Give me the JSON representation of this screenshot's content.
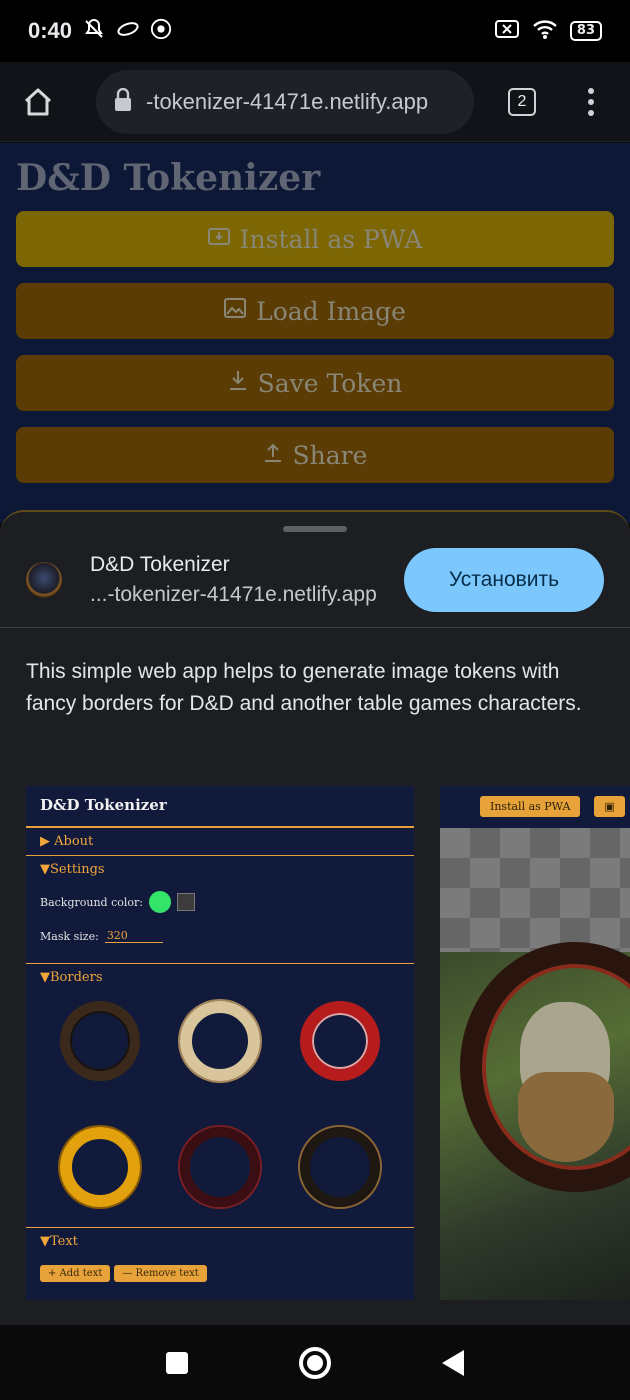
{
  "status_bar": {
    "time": "0:40",
    "battery": "83"
  },
  "browser": {
    "url": "-tokenizer-41471e.netlify.app",
    "tab_count": "2"
  },
  "page": {
    "title": "D&D Tokenizer",
    "buttons": {
      "install": "Install as PWA",
      "load": "Load Image",
      "save": "Save Token",
      "share": "Share"
    }
  },
  "install_sheet": {
    "app_name": "D&D Tokenizer",
    "app_url": "...-tokenizer-41471e.netlify.app",
    "install_button": "Установить",
    "description": "This simple web app helps to generate image tokens with fancy borders for D&D and another table games characters.",
    "screenshot1": {
      "title": "D&D Tokenizer",
      "about": "About",
      "settings": "Settings",
      "background_color_label": "Background color:",
      "mask_size_label": "Mask size:",
      "mask_size_value": "320",
      "borders": "Borders",
      "text": "Text",
      "add_text": "+ Add text",
      "remove_text": "— Remove text"
    },
    "screenshot2": {
      "install_button": "Install as PWA"
    }
  },
  "colors": {
    "page_bg": "#0c1836",
    "install_btn": "#7cc7fb",
    "accent_orange": "#e8a23a"
  }
}
